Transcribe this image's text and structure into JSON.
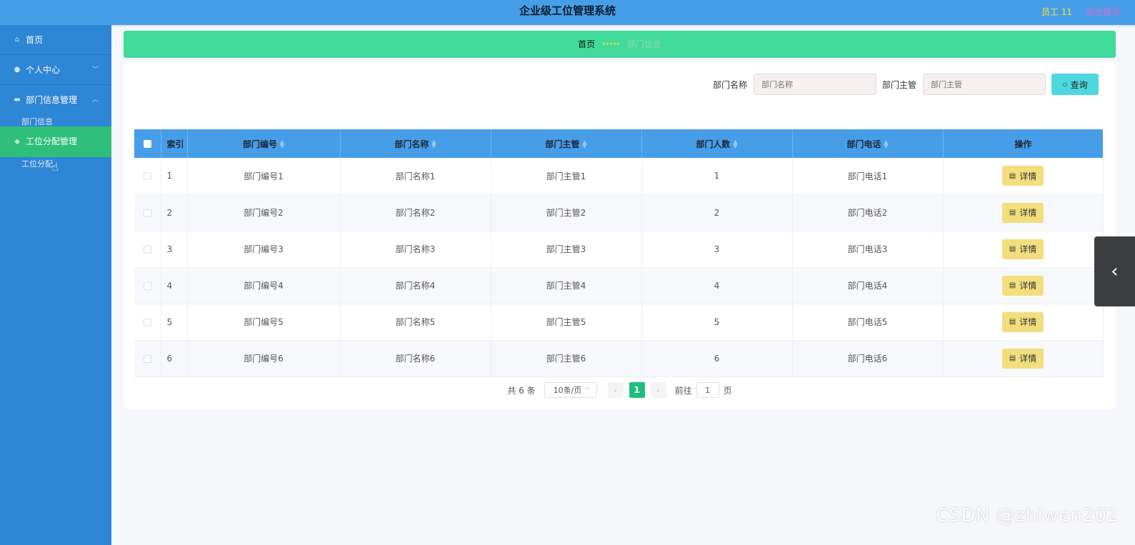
{
  "header": {
    "title": "企业级工位管理系统",
    "user": "员工 11",
    "logout": "退出登录"
  },
  "sidebar": {
    "items": [
      {
        "label": "首页",
        "icon": "home-icon"
      },
      {
        "label": "个人中心",
        "icon": "user-icon"
      },
      {
        "label": "部门信息管理",
        "icon": "briefcase-icon"
      },
      {
        "label": "部门信息",
        "icon": ""
      },
      {
        "label": "工位分配管理",
        "icon": "seat-icon"
      },
      {
        "label": "工位分配",
        "icon": ""
      }
    ]
  },
  "breadcrumb": {
    "home": "首页",
    "separator": "*****",
    "current": "部门信息"
  },
  "search": {
    "name_label": "部门名称",
    "name_placeholder": "部门名称",
    "manager_label": "部门主管",
    "manager_placeholder": "部门主管",
    "query_button": "查询"
  },
  "table": {
    "headers": [
      "索引",
      "部门编号",
      "部门名称",
      "部门主管",
      "部门人数",
      "部门电话",
      "操作"
    ],
    "detail_label": "详情",
    "rows": [
      {
        "idx": "1",
        "code": "部门编号1",
        "name": "部门名称1",
        "manager": "部门主管1",
        "count": "1",
        "phone": "部门电话1"
      },
      {
        "idx": "2",
        "code": "部门编号2",
        "name": "部门名称2",
        "manager": "部门主管2",
        "count": "2",
        "phone": "部门电话2"
      },
      {
        "idx": "3",
        "code": "部门编号3",
        "name": "部门名称3",
        "manager": "部门主管3",
        "count": "3",
        "phone": "部门电话3"
      },
      {
        "idx": "4",
        "code": "部门编号4",
        "name": "部门名称4",
        "manager": "部门主管4",
        "count": "4",
        "phone": "部门电话4"
      },
      {
        "idx": "5",
        "code": "部门编号5",
        "name": "部门名称5",
        "manager": "部门主管5",
        "count": "5",
        "phone": "部门电话5"
      },
      {
        "idx": "6",
        "code": "部门编号6",
        "name": "部门名称6",
        "manager": "部门主管6",
        "count": "6",
        "phone": "部门电话6"
      }
    ]
  },
  "pagination": {
    "total": "共 6 条",
    "page_size": "10条/页",
    "current_page": "1",
    "goto_label": "前往",
    "goto_value": "1",
    "page_unit": "页"
  },
  "watermark": "CSDN @zhiwen202",
  "colors": {
    "header": "#479ee8",
    "sidebar": "#2e86d6",
    "active_menu": "#2fbf7a",
    "breadcrumb": "#40db98",
    "query_button": "#4dd8e0",
    "detail_button": "#f2de7d",
    "active_page": "#1fbd7e"
  }
}
